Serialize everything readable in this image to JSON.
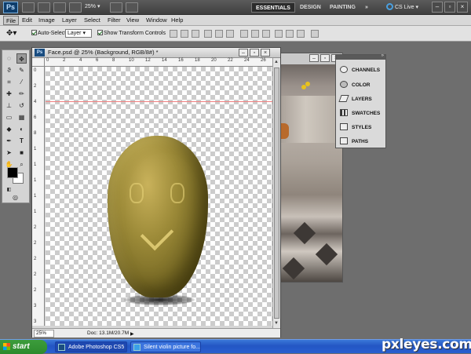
{
  "app": {
    "logo_text": "Ps",
    "zoom": "25%"
  },
  "workspace": {
    "essentials": "ESSENTIALS",
    "design": "DESIGN",
    "painting": "PAINTING",
    "more": "»",
    "cslive": "CS Live",
    "cslive_arrow": "▾"
  },
  "window_controls": {
    "minimize": "–",
    "restore": "▫",
    "close": "×"
  },
  "menu": [
    "File",
    "Edit",
    "Image",
    "Layer",
    "Select",
    "Filter",
    "View",
    "Window",
    "Help"
  ],
  "options": {
    "auto_select_label": "Auto-Select:",
    "auto_select_value": "Layer",
    "transform_label": "Show Transform Controls"
  },
  "document": {
    "title": "Face.psd @ 25% (Background, RGB/8#) *",
    "zoom": "25%",
    "doc_info": "Doc: 13.1M/20.7M",
    "ruler_h": [
      "0",
      "2",
      "4",
      "6",
      "8",
      "10",
      "12",
      "14",
      "16",
      "18",
      "20",
      "22",
      "24",
      "26"
    ],
    "ruler_v": [
      "0",
      "2",
      "4",
      "6",
      "8",
      "1",
      "1",
      "1",
      "1",
      "1",
      "2",
      "2",
      "2",
      "2",
      "2",
      "3",
      "3"
    ]
  },
  "panel": {
    "items": [
      "CHANNELS",
      "COLOR",
      "LAYERS",
      "SWATCHES",
      "STYLES",
      "PATHS"
    ]
  },
  "taskbar": {
    "start": "start",
    "tasks": [
      "Adobe Photoshop CS5",
      "Silent violin picture fo..."
    ]
  },
  "watermark": "pxleyes.com"
}
